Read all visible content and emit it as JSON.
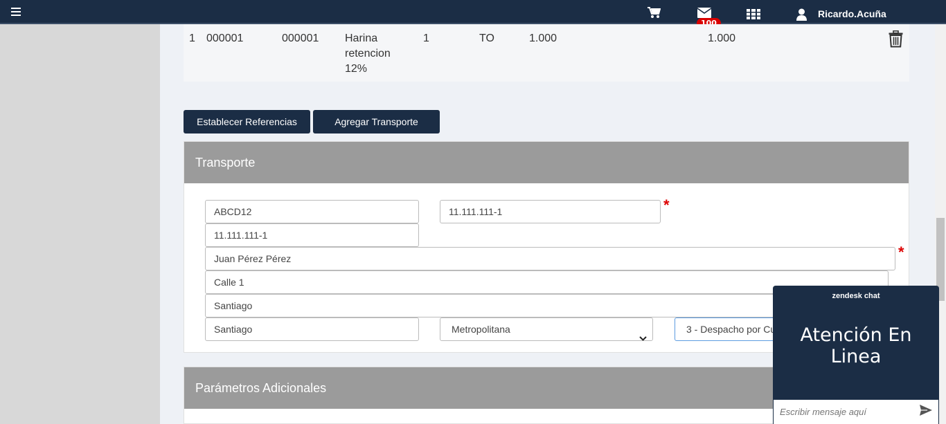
{
  "topbar": {
    "cart_icon": "cart-icon",
    "mail_icon": "mail-icon",
    "mail_badge": "100",
    "apps_icon": "grid-icon",
    "user_icon": "user-icon",
    "username": "Ricardo.Acuña",
    "bg_color": "#1b2d45"
  },
  "product_row": {
    "index": "1",
    "code1": "000001",
    "code2": "000001",
    "description": [
      "Harina",
      "retencion",
      "12%"
    ],
    "quantity": "1",
    "unit": "TO",
    "price": "1.000",
    "total": "1.000",
    "delete_icon": "trash-icon"
  },
  "actions": {
    "establish_references": "Establecer Referencias",
    "add_transport": "Agregar Transporte"
  },
  "transport": {
    "title": "Transporte",
    "patente": "ABCD12",
    "rut_transportista": "11.111.111-1",
    "rut_chofer": "11.111.111-1",
    "nombre_chofer": "Juan Pérez Pérez",
    "direccion": "Calle 1",
    "comuna": "Santiago",
    "ciudad": "Santiago",
    "region": "Metropolitana",
    "tipo_despacho": "3 - Despacho por Cu",
    "required_mark": "*"
  },
  "additional": {
    "title": "Parámetros Adicionales"
  },
  "chat": {
    "brand": "zendesk chat",
    "title_line1": "Atención En",
    "title_line2": "Linea",
    "placeholder": "Escribir mensaje aquí",
    "send_icon": "send-icon"
  }
}
